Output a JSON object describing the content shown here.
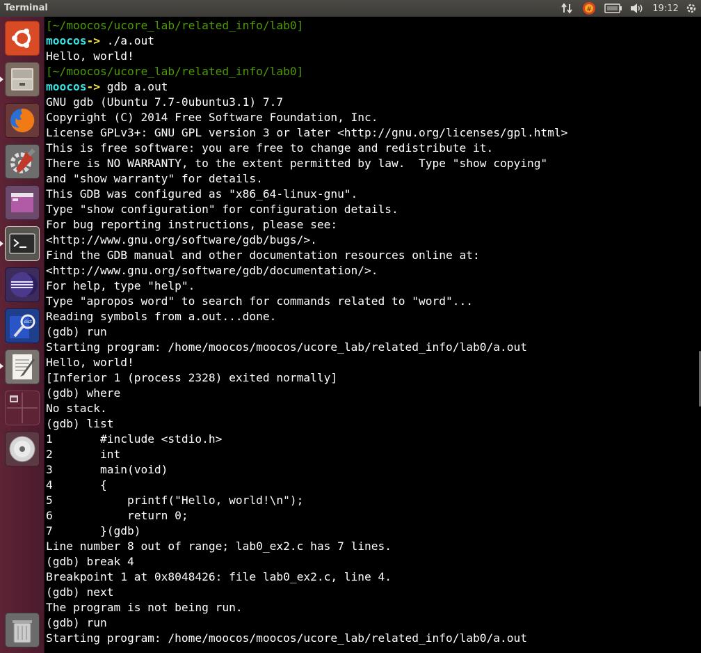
{
  "top_bar": {
    "title": "Terminal",
    "clock": "19:12",
    "icons": [
      "network-updown-icon",
      "input-method-icon",
      "battery-icon",
      "volume-icon"
    ]
  },
  "launcher": {
    "items": [
      {
        "name": "ubuntu-dash-icon"
      },
      {
        "name": "files-icon"
      },
      {
        "name": "firefox-icon"
      },
      {
        "name": "system-settings-icon"
      },
      {
        "name": "app-window-icon"
      },
      {
        "name": "terminal-icon"
      },
      {
        "name": "eclipse-icon"
      },
      {
        "name": "dictionary-icon"
      },
      {
        "name": "text-editor-icon"
      },
      {
        "name": "workspace-switcher-icon"
      },
      {
        "name": "cd-drive-icon"
      },
      {
        "name": "trash-icon"
      }
    ]
  },
  "terminal": {
    "lines": [
      {
        "type": "dir",
        "text": "[~/moocos/ucore_lab/related_info/lab0]"
      },
      {
        "type": "prompt",
        "user": "moocos",
        "arrow": "->",
        "cmd": " ./a.out"
      },
      {
        "type": "out",
        "text": "Hello, world!"
      },
      {
        "type": "dir",
        "text": "[~/moocos/ucore_lab/related_info/lab0]"
      },
      {
        "type": "prompt",
        "user": "moocos",
        "arrow": "->",
        "cmd": " gdb a.out"
      },
      {
        "type": "out",
        "text": "GNU gdb (Ubuntu 7.7-0ubuntu3.1) 7.7"
      },
      {
        "type": "out",
        "text": "Copyright (C) 2014 Free Software Foundation, Inc."
      },
      {
        "type": "out",
        "text": "License GPLv3+: GNU GPL version 3 or later <http://gnu.org/licenses/gpl.html>"
      },
      {
        "type": "out",
        "text": "This is free software: you are free to change and redistribute it."
      },
      {
        "type": "out",
        "text": "There is NO WARRANTY, to the extent permitted by law.  Type \"show copying\""
      },
      {
        "type": "out",
        "text": "and \"show warranty\" for details."
      },
      {
        "type": "out",
        "text": "This GDB was configured as \"x86_64-linux-gnu\"."
      },
      {
        "type": "out",
        "text": "Type \"show configuration\" for configuration details."
      },
      {
        "type": "out",
        "text": "For bug reporting instructions, please see:"
      },
      {
        "type": "out",
        "text": "<http://www.gnu.org/software/gdb/bugs/>."
      },
      {
        "type": "out",
        "text": "Find the GDB manual and other documentation resources online at:"
      },
      {
        "type": "out",
        "text": "<http://www.gnu.org/software/gdb/documentation/>."
      },
      {
        "type": "out",
        "text": "For help, type \"help\"."
      },
      {
        "type": "out",
        "text": "Type \"apropos word\" to search for commands related to \"word\"..."
      },
      {
        "type": "out",
        "text": "Reading symbols from a.out...done."
      },
      {
        "type": "out",
        "text": "(gdb) run"
      },
      {
        "type": "out",
        "text": "Starting program: /home/moocos/moocos/ucore_lab/related_info/lab0/a.out"
      },
      {
        "type": "out",
        "text": "Hello, world!"
      },
      {
        "type": "out",
        "text": "[Inferior 1 (process 2328) exited normally]"
      },
      {
        "type": "out",
        "text": "(gdb) where"
      },
      {
        "type": "out",
        "text": "No stack."
      },
      {
        "type": "out",
        "text": "(gdb) list"
      },
      {
        "type": "out",
        "text": "1\t#include <stdio.h>"
      },
      {
        "type": "out",
        "text": "2\tint"
      },
      {
        "type": "out",
        "text": "3\tmain(void)"
      },
      {
        "type": "out",
        "text": "4\t{"
      },
      {
        "type": "out",
        "text": "5\t    printf(\"Hello, world!\\n\");"
      },
      {
        "type": "out",
        "text": "6\t    return 0;"
      },
      {
        "type": "out",
        "text": "7\t}(gdb)"
      },
      {
        "type": "out",
        "text": "Line number 8 out of range; lab0_ex2.c has 7 lines."
      },
      {
        "type": "out",
        "text": "(gdb) break 4"
      },
      {
        "type": "out",
        "text": "Breakpoint 1 at 0x8048426: file lab0_ex2.c, line 4."
      },
      {
        "type": "out",
        "text": "(gdb) next"
      },
      {
        "type": "out",
        "text": "The program is not being run."
      },
      {
        "type": "out",
        "text": "(gdb) run"
      },
      {
        "type": "out",
        "text": "Starting program: /home/moocos/moocos/ucore_lab/related_info/lab0/a.out"
      }
    ]
  }
}
